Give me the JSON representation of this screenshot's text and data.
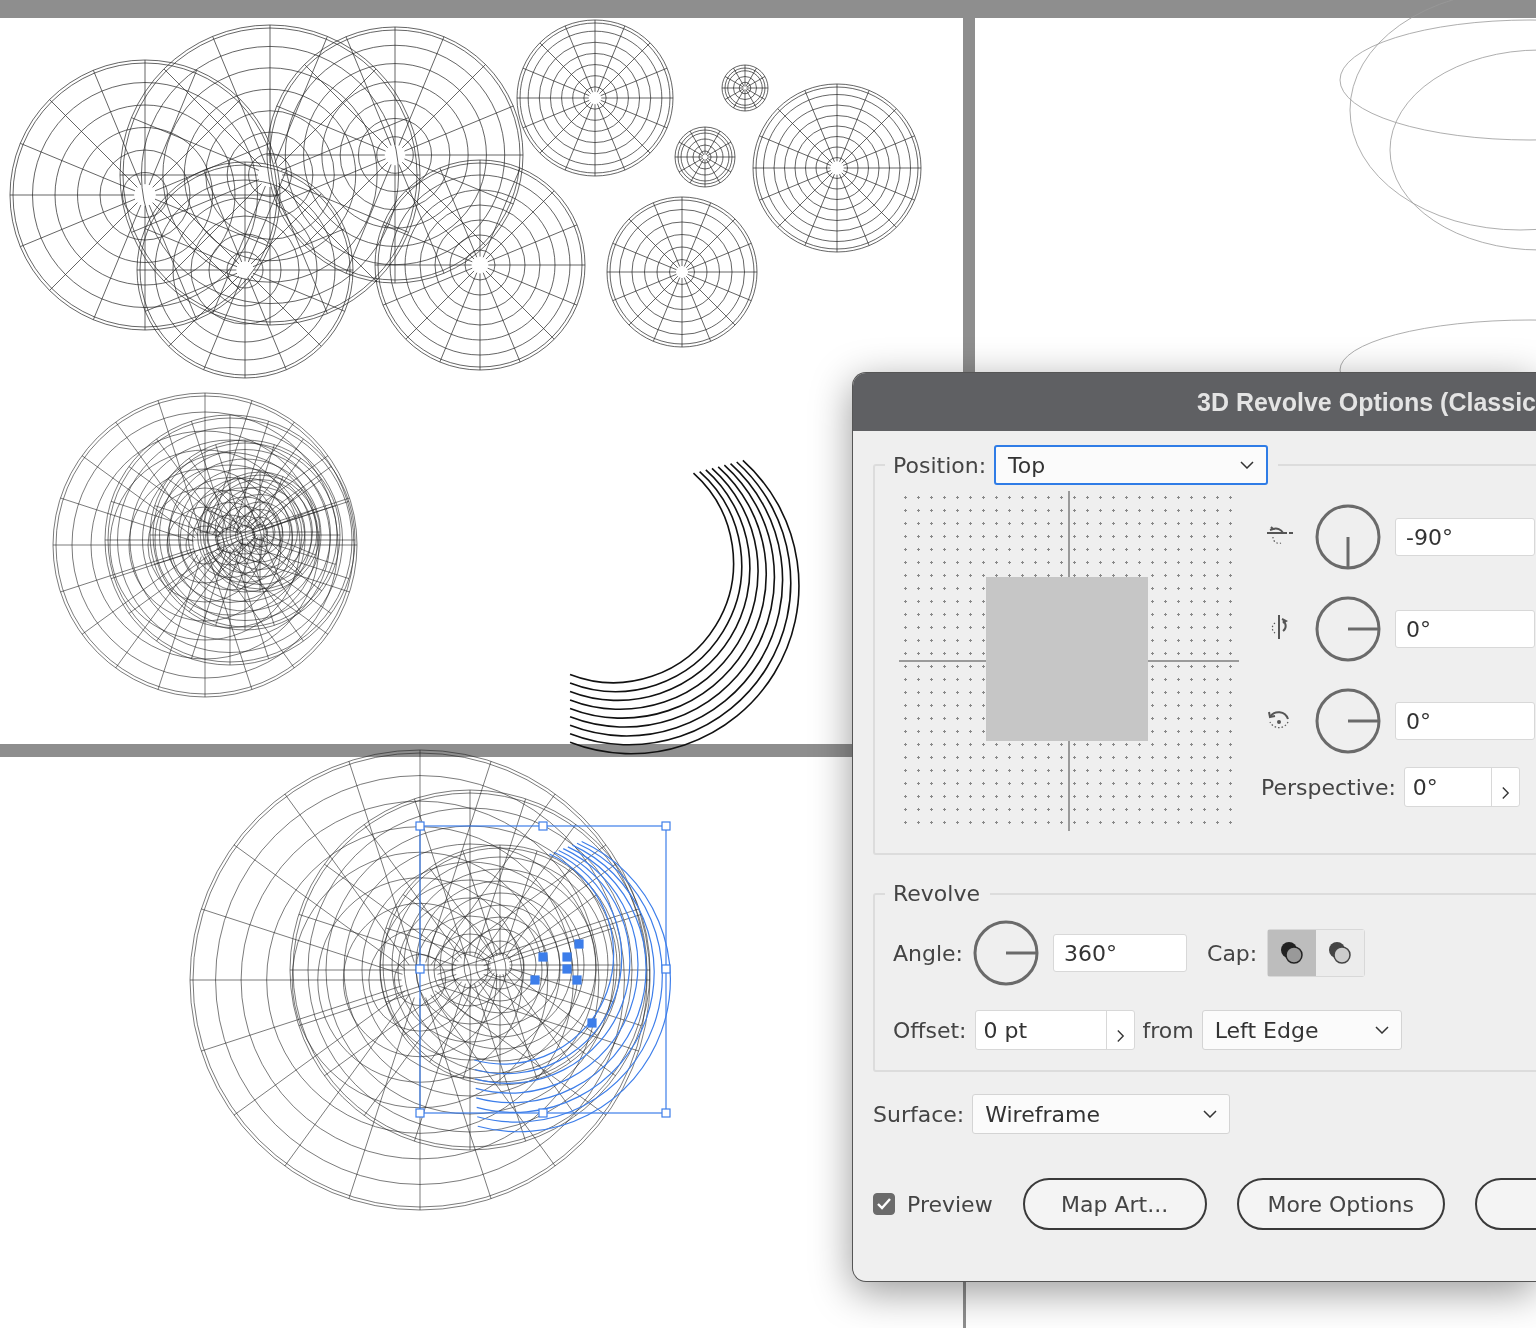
{
  "dialog": {
    "title": "3D Revolve Options (Classic",
    "position": {
      "label": "Position:",
      "value": "Top"
    },
    "rotation": [
      {
        "kind": "x",
        "value": "-90°"
      },
      {
        "kind": "y",
        "value": "0°"
      },
      {
        "kind": "z",
        "value": "0°"
      }
    ],
    "perspective": {
      "label": "Perspective:",
      "value": "0°"
    },
    "revolve": {
      "title": "Revolve",
      "angle": {
        "label": "Angle:",
        "value": "360°"
      },
      "cap": {
        "label": "Cap:",
        "options": [
          {
            "kind": "on",
            "selected": true
          },
          {
            "kind": "off",
            "selected": false
          }
        ]
      },
      "offset": {
        "label": "Offset:",
        "value": "0 pt"
      },
      "from": {
        "label": "from",
        "value": "Left Edge"
      }
    },
    "surface": {
      "label": "Surface:",
      "value": "Wireframe"
    },
    "preview": {
      "label": "Preview",
      "checked": true
    },
    "buttons": [
      "Map Art...",
      "More Options"
    ]
  }
}
